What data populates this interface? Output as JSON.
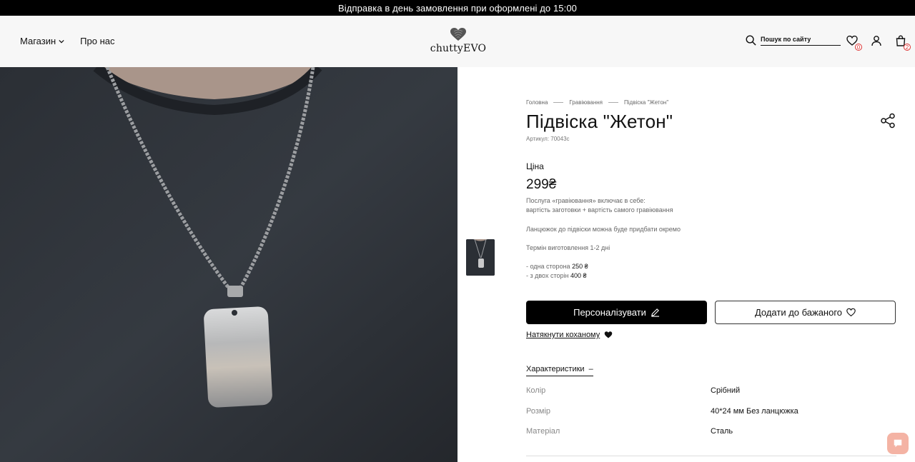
{
  "announcement": "Відправка в день замовлення при оформлені до 15:00",
  "header": {
    "nav": {
      "shop": "Магазин",
      "about": "Про нас"
    },
    "logo_text": "chuttyEVO",
    "search_placeholder": "Пошук по сайту",
    "wishlist_count": "0",
    "cart_count": "2"
  },
  "breadcrumb": [
    "Головна",
    "Гравіювання",
    "Підвіска \"Жетон\""
  ],
  "product": {
    "title": "Підвіска \"Жетон\"",
    "sku": "Артикул: 70043с",
    "price_label": "Ціна",
    "price": "299₴",
    "desc_line1": "Послуга «гравіювання» включає в себе:",
    "desc_line2": "вартість заготовки + вартість самого гравіювання",
    "chain_note": "Ланцюжок до підвіски можна буде придбати окремо",
    "lead_time": "Термін виготовлення 1-2 дні",
    "option1_label": "- одна сторона",
    "option1_price": "250 ₴",
    "option2_label": "- з двох сторін",
    "option2_price": "400 ₴"
  },
  "buttons": {
    "personalize": "Персоналізувати",
    "wishlist": "Додати до бажаного",
    "hint": "Натякнути коханому"
  },
  "specs": {
    "heading": "Характеристики",
    "rows": [
      {
        "key": "Колір",
        "value": "Срібний"
      },
      {
        "key": "Розмір",
        "value": "40*24 мм Без ланцюжка"
      },
      {
        "key": "Матеріал",
        "value": "Сталь"
      }
    ]
  }
}
